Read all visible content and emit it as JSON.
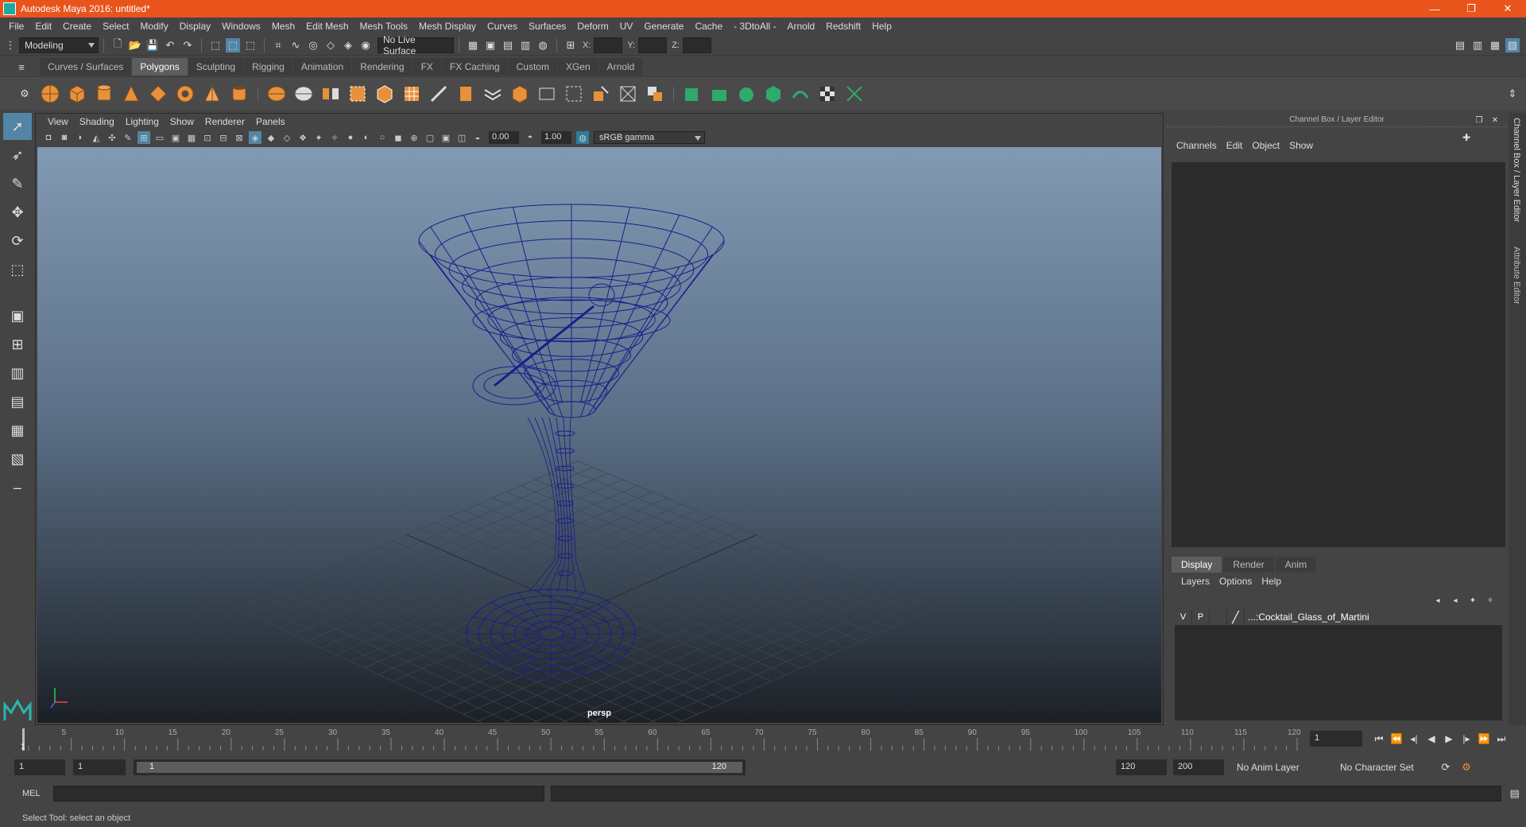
{
  "window": {
    "title": "Autodesk Maya 2016: untitled*",
    "controls": [
      "—",
      "❐",
      "✕"
    ]
  },
  "menubar": [
    "File",
    "Edit",
    "Create",
    "Select",
    "Modify",
    "Display",
    "Windows",
    "Mesh",
    "Edit Mesh",
    "Mesh Tools",
    "Mesh Display",
    "Curves",
    "Surfaces",
    "Deform",
    "UV",
    "Generate",
    "Cache",
    "- 3DtoAll -",
    "Arnold",
    "Redshift",
    "Help"
  ],
  "statusline": {
    "mode": "Modeling",
    "live_surface": "No Live Surface",
    "x_label": "X:",
    "y_label": "Y:",
    "z_label": "Z:"
  },
  "shelf_tabs": [
    {
      "label": "Curves / Surfaces",
      "active": false
    },
    {
      "label": "Polygons",
      "active": true
    },
    {
      "label": "Sculpting",
      "active": false
    },
    {
      "label": "Rigging",
      "active": false
    },
    {
      "label": "Animation",
      "active": false
    },
    {
      "label": "Rendering",
      "active": false
    },
    {
      "label": "FX",
      "active": false
    },
    {
      "label": "FX Caching",
      "active": false
    },
    {
      "label": "Custom",
      "active": false
    },
    {
      "label": "XGen",
      "active": false
    },
    {
      "label": "Arnold",
      "active": false
    }
  ],
  "viewport": {
    "menu": [
      "View",
      "Shading",
      "Lighting",
      "Show",
      "Renderer",
      "Panels"
    ],
    "exposure": "0.00",
    "gamma": "1.00",
    "color_space": "sRGB gamma",
    "camera": "persp",
    "wire_color": "#1a1e8a"
  },
  "channel_box": {
    "header": "Channel Box / Layer Editor",
    "menu": [
      "Channels",
      "Edit",
      "Object",
      "Show"
    ]
  },
  "layer_editor": {
    "tabs": [
      {
        "label": "Display",
        "active": true
      },
      {
        "label": "Render",
        "active": false
      },
      {
        "label": "Anim",
        "active": false
      }
    ],
    "menu": [
      "Layers",
      "Options",
      "Help"
    ],
    "layers": [
      {
        "v": "V",
        "p": "P",
        "name": "...:Cocktail_Glass_of_Martini"
      }
    ]
  },
  "side_tabs": [
    "Channel Box / Layer Editor",
    "Attribute Editor"
  ],
  "timeline": {
    "ticks": [
      "5",
      "10",
      "15",
      "20",
      "25",
      "30",
      "35",
      "40",
      "45",
      "50",
      "55",
      "60",
      "65",
      "70",
      "75",
      "80",
      "85",
      "90",
      "95",
      "100",
      "105",
      "110",
      "115",
      "120"
    ],
    "start_label": "1",
    "current_frame": "1"
  },
  "range": {
    "start": "1",
    "playback_start": "1",
    "slider_start": "1",
    "slider_end": "120",
    "playback_end": "120",
    "end": "200",
    "anim_layer": "No Anim Layer",
    "character_set": "No Character Set"
  },
  "mel": {
    "label": "MEL"
  },
  "help_line": "Select Tool: select an object"
}
